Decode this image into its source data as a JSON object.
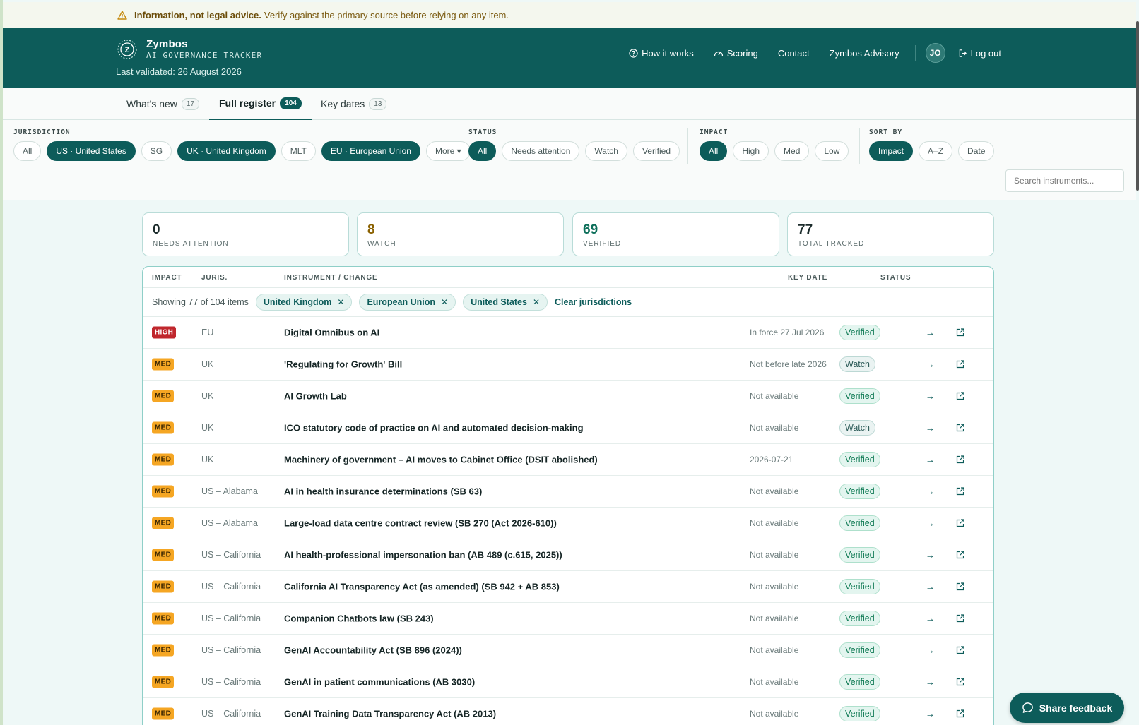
{
  "disclaimer": {
    "bold": "Information, not legal advice.",
    "text": "Verify against the primary source before relying on any item."
  },
  "brand": {
    "name": "Zymbos",
    "subtitle": "AI GOVERNANCE TRACKER",
    "logo_letter": "Z",
    "validated": "Last validated: 26 August 2026"
  },
  "nav": {
    "how_it_works": "How it works",
    "scoring": "Scoring",
    "contact": "Contact",
    "advisory": "Zymbos Advisory",
    "avatar": "JO",
    "logout": "Log out"
  },
  "tabs": [
    {
      "label": "What's new",
      "count": "17"
    },
    {
      "label": "Full register",
      "count": "104"
    },
    {
      "label": "Key dates",
      "count": "13"
    }
  ],
  "filters": {
    "jurisdiction": {
      "label": "JURISDICTION",
      "chips": [
        "All",
        "US · United States",
        "SG",
        "UK · United Kingdom",
        "MLT",
        "EU · European Union",
        "More ▾"
      ]
    },
    "status": {
      "label": "STATUS",
      "chips": [
        "All",
        "Needs attention",
        "Watch",
        "Verified"
      ]
    },
    "impact": {
      "label": "IMPACT",
      "chips": [
        "All",
        "High",
        "Med",
        "Low"
      ]
    },
    "sort": {
      "label": "SORT BY",
      "chips": [
        "Impact",
        "A–Z",
        "Date"
      ]
    },
    "search_placeholder": "Search instruments..."
  },
  "summary": [
    {
      "value": "0",
      "label": "NEEDS ATTENTION"
    },
    {
      "value": "8",
      "label": "WATCH"
    },
    {
      "value": "69",
      "label": "VERIFIED"
    },
    {
      "value": "77",
      "label": "TOTAL TRACKED"
    }
  ],
  "table": {
    "headers": {
      "impact": "IMPACT",
      "juris": "JURIS.",
      "instrument": "INSTRUMENT / CHANGE",
      "key_date": "KEY DATE",
      "status": "STATUS"
    },
    "showing": "Showing 77 of 104 items",
    "active_filters": [
      "United Kingdom",
      "European Union",
      "United States"
    ],
    "clear": "Clear jurisdictions",
    "rows": [
      {
        "impact": "HIGH",
        "juris": "EU",
        "instrument": "Digital Omnibus on AI",
        "date": "In force 27 Jul 2026",
        "status": "Verified"
      },
      {
        "impact": "MED",
        "juris": "UK",
        "instrument": "'Regulating for Growth' Bill",
        "date": "Not before late 2026",
        "status": "Watch"
      },
      {
        "impact": "MED",
        "juris": "UK",
        "instrument": "AI Growth Lab",
        "date": "Not available",
        "status": "Verified"
      },
      {
        "impact": "MED",
        "juris": "UK",
        "instrument": "ICO statutory code of practice on AI and automated decision-making",
        "date": "Not available",
        "status": "Watch"
      },
      {
        "impact": "MED",
        "juris": "UK",
        "instrument": "Machinery of government – AI moves to Cabinet Office (DSIT abolished)",
        "date": "2026-07-21",
        "status": "Verified"
      },
      {
        "impact": "MED",
        "juris": "US – Alabama",
        "instrument": "AI in health insurance determinations (SB 63)",
        "date": "Not available",
        "status": "Verified"
      },
      {
        "impact": "MED",
        "juris": "US – Alabama",
        "instrument": "Large-load data centre contract review (SB 270 (Act 2026-610))",
        "date": "Not available",
        "status": "Verified"
      },
      {
        "impact": "MED",
        "juris": "US – California",
        "instrument": "AI health-professional impersonation ban (AB 489 (c.615, 2025))",
        "date": "Not available",
        "status": "Verified"
      },
      {
        "impact": "MED",
        "juris": "US – California",
        "instrument": "California AI Transparency Act (as amended) (SB 942 + AB 853)",
        "date": "Not available",
        "status": "Verified"
      },
      {
        "impact": "MED",
        "juris": "US – California",
        "instrument": "Companion Chatbots law (SB 243)",
        "date": "Not available",
        "status": "Verified"
      },
      {
        "impact": "MED",
        "juris": "US – California",
        "instrument": "GenAI Accountability Act (SB 896 (2024))",
        "date": "Not available",
        "status": "Verified"
      },
      {
        "impact": "MED",
        "juris": "US – California",
        "instrument": "GenAI in patient communications (AB 3030)",
        "date": "Not available",
        "status": "Verified"
      },
      {
        "impact": "MED",
        "juris": "US – California",
        "instrument": "GenAI Training Data Transparency Act (AB 2013)",
        "date": "Not available",
        "status": "Verified"
      }
    ]
  },
  "feedback": "Share feedback",
  "colors": {
    "brand": "#0d5c5a",
    "high": "#c0272d",
    "med": "#f5a623",
    "watch_num": "#8a6100",
    "verified_num": "#0d6f5a"
  }
}
